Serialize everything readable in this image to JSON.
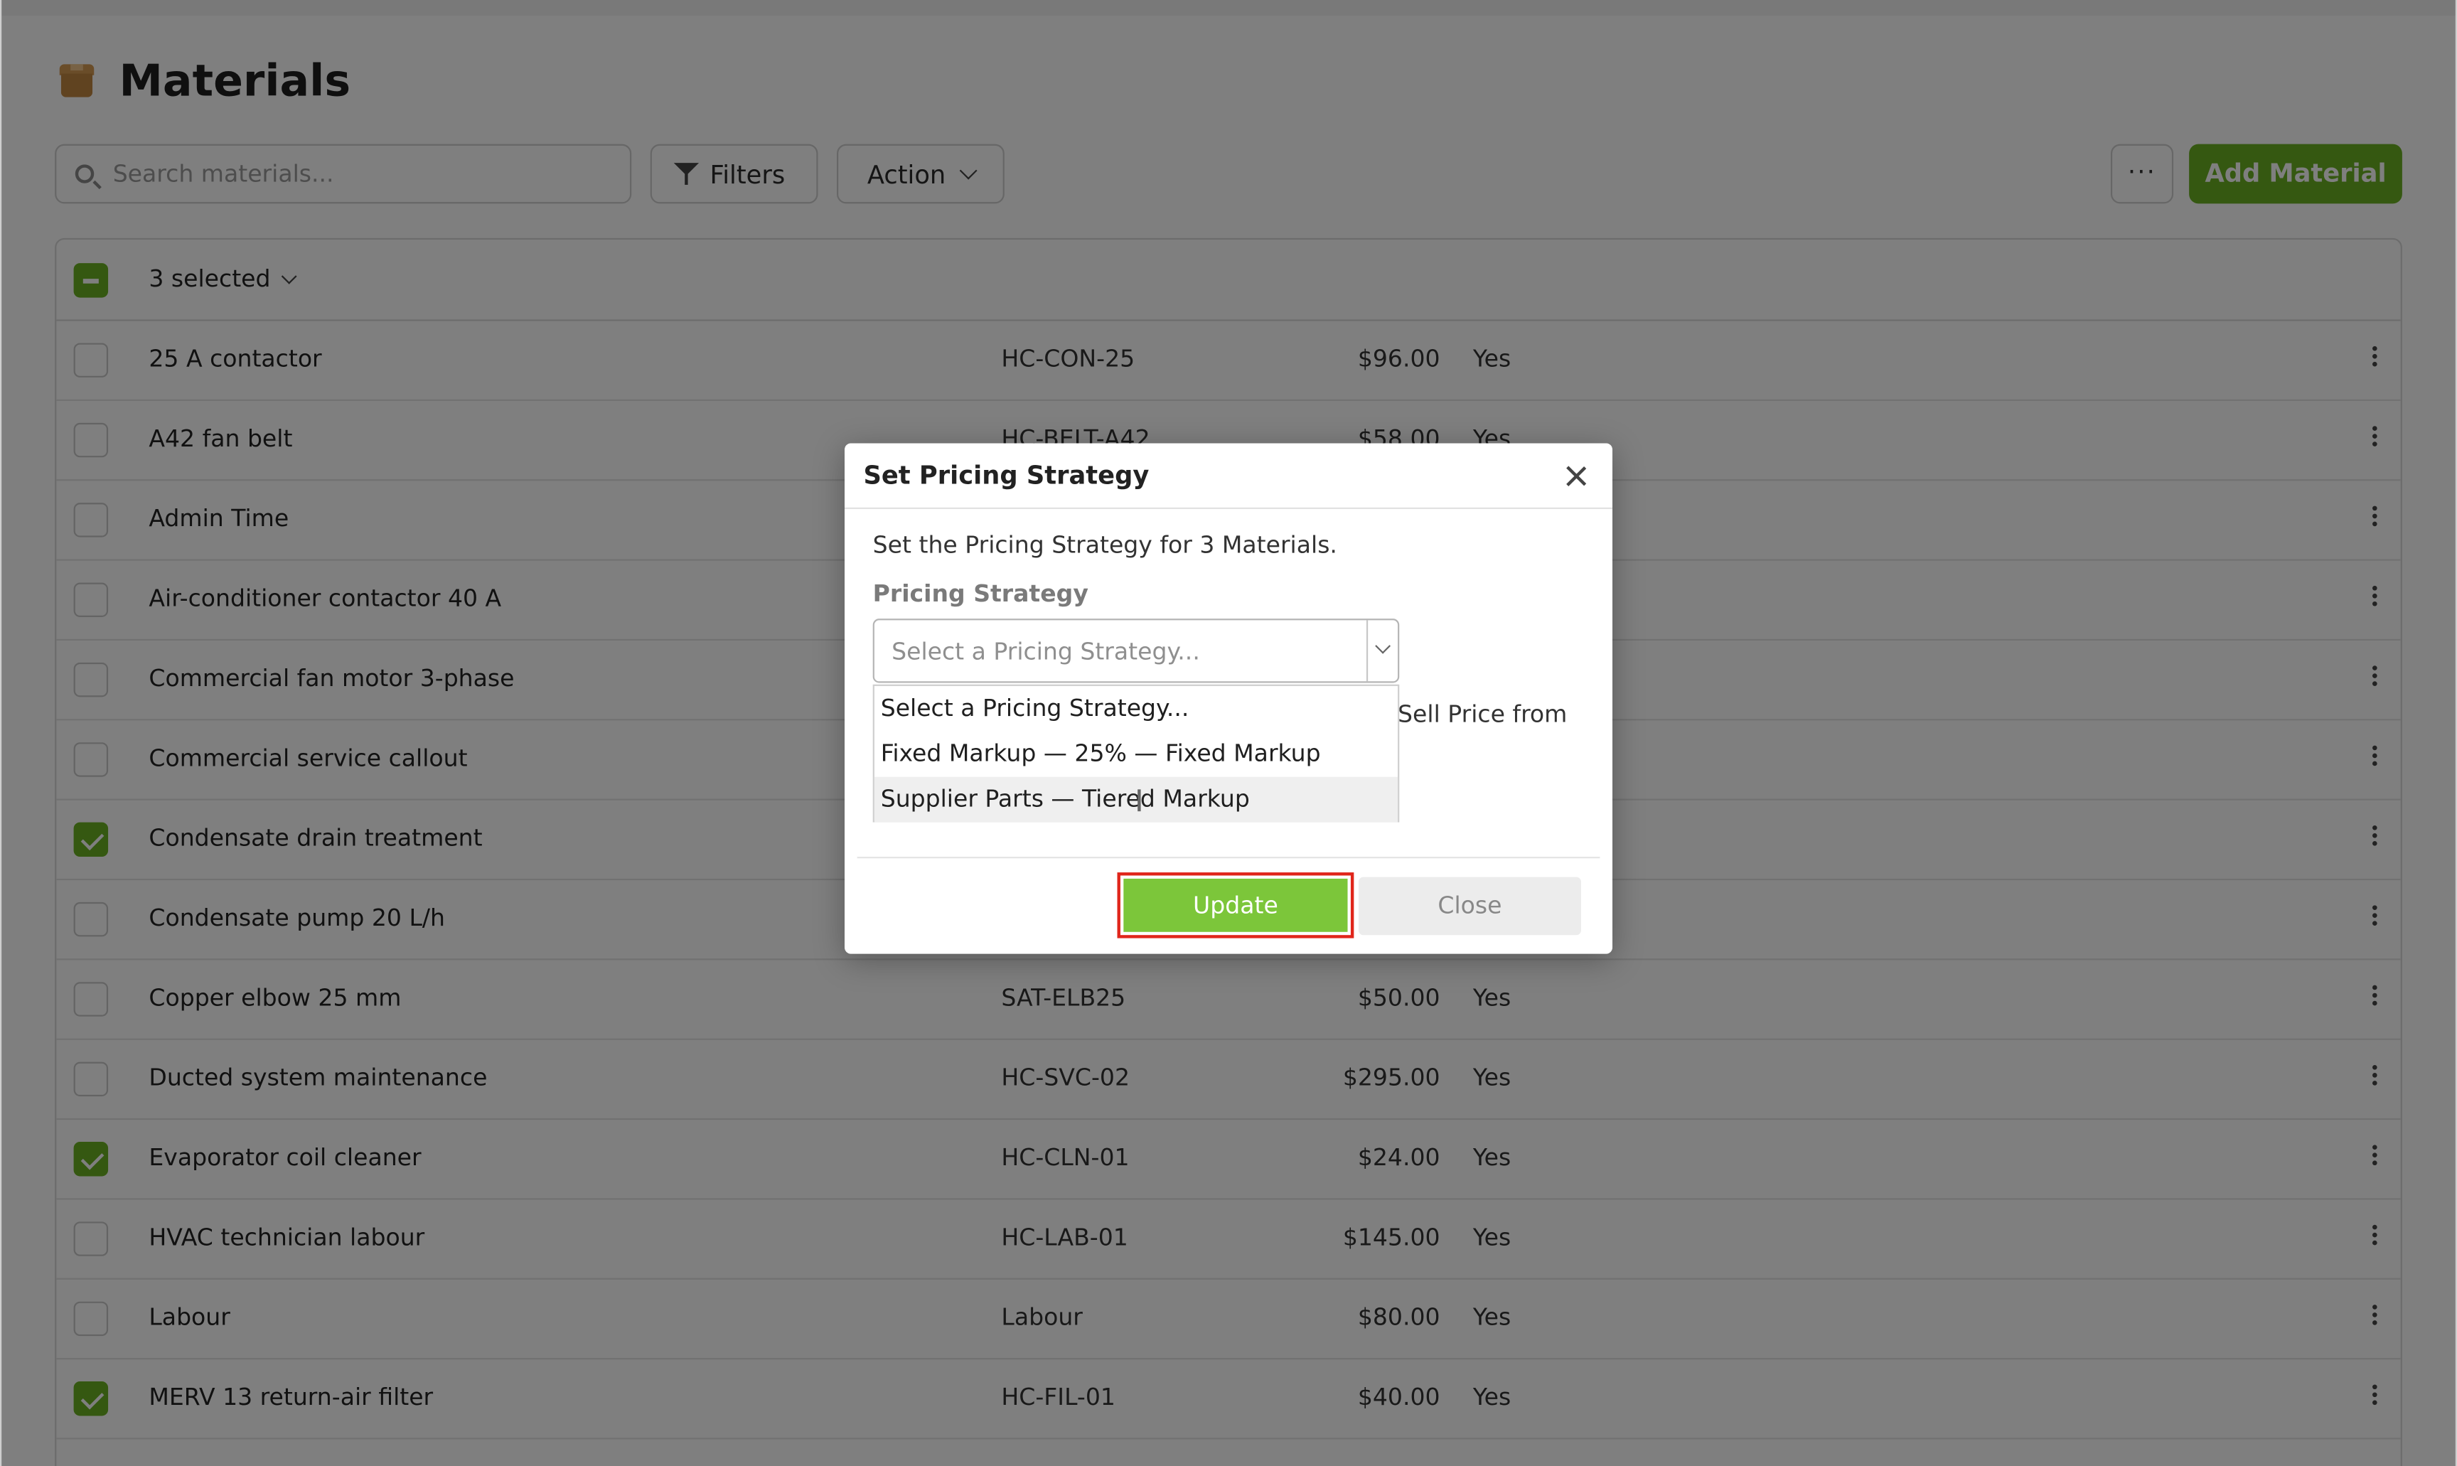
{
  "page": {
    "title": "Materials",
    "icon": "package-box-icon"
  },
  "toolbar": {
    "search_placeholder": "Search materials...",
    "filters_label": "Filters",
    "action_label": "Action",
    "more_label": "···",
    "add_label": "Add Material"
  },
  "table": {
    "selection_label": "3 selected",
    "rows": [
      {
        "name": "25 A contactor",
        "sku": "HC-CON-25",
        "price": "$96.00",
        "taxable": "Yes",
        "checked": false
      },
      {
        "name": "A42 fan belt",
        "sku": "HC-BELT-A42",
        "price": "$58.00",
        "taxable": "Yes",
        "checked": false
      },
      {
        "name": "Admin Time",
        "sku": "",
        "price": "",
        "taxable": "",
        "checked": false
      },
      {
        "name": "Air-conditioner contactor 40 A",
        "sku": "",
        "price": "",
        "taxable": "",
        "checked": false
      },
      {
        "name": "Commercial fan motor 3-phase",
        "sku": "",
        "price": "",
        "taxable": "",
        "checked": false
      },
      {
        "name": "Commercial service callout",
        "sku": "",
        "price": "",
        "taxable": "",
        "checked": false
      },
      {
        "name": "Condensate drain treatment",
        "sku": "",
        "price": "",
        "taxable": "",
        "checked": true
      },
      {
        "name": "Condensate pump 20 L/h",
        "sku": "",
        "price": "",
        "taxable": "",
        "checked": false
      },
      {
        "name": "Copper elbow 25 mm",
        "sku": "SAT-ELB25",
        "price": "$50.00",
        "taxable": "Yes",
        "checked": false
      },
      {
        "name": "Ducted system maintenance",
        "sku": "HC-SVC-02",
        "price": "$295.00",
        "taxable": "Yes",
        "checked": false
      },
      {
        "name": "Evaporator coil cleaner",
        "sku": "HC-CLN-01",
        "price": "$24.00",
        "taxable": "Yes",
        "checked": true
      },
      {
        "name": "HVAC technician labour",
        "sku": "HC-LAB-01",
        "price": "$145.00",
        "taxable": "Yes",
        "checked": false
      },
      {
        "name": "Labour",
        "sku": "Labour",
        "price": "$80.00",
        "taxable": "Yes",
        "checked": false
      },
      {
        "name": "MERV 13 return-air filter",
        "sku": "HC-FIL-01",
        "price": "$40.00",
        "taxable": "Yes",
        "checked": true
      }
    ]
  },
  "modal": {
    "title": "Set Pricing Strategy",
    "description": "Set the Pricing Strategy for 3 Materials.",
    "field_label": "Pricing Strategy",
    "select_placeholder": "Select a Pricing Strategy...",
    "options": [
      "Select a Pricing Strategy...",
      "Fixed Markup — 25% — Fixed Markup",
      "Supplier Parts — Tiered Markup"
    ],
    "partial_text_behind": "Sell Price from",
    "update_label": "Update",
    "close_label": "Close"
  },
  "colors": {
    "brand_green": "#6ab023",
    "update_green": "#7cc63a",
    "highlight_red": "#e0261b"
  }
}
